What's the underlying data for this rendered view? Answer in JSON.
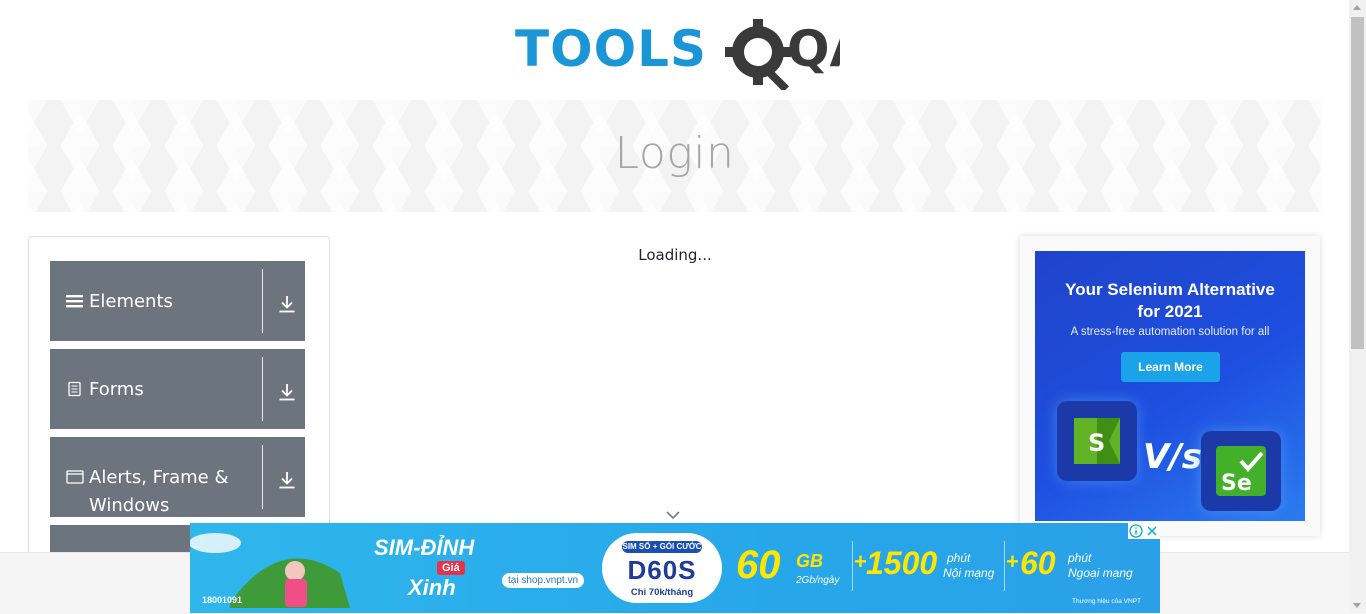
{
  "header": {
    "logo_text_left": "TOOLS",
    "logo_text_right": "QA",
    "logo_colors": {
      "tools": "#1a96d6",
      "qa": "#3a3a3a"
    }
  },
  "banner": {
    "title": "Login"
  },
  "sidebar": {
    "groups": [
      {
        "label": "Elements",
        "icon": "menu-bars-icon"
      },
      {
        "label": "Forms",
        "icon": "document-icon"
      },
      {
        "label": "Alerts, Frame & Windows",
        "icon": "window-icon"
      }
    ]
  },
  "main": {
    "loading_text": "Loading..."
  },
  "ad_right": {
    "headline_line1": "Your Selenium Alternative",
    "headline_line2": "for 2021",
    "subline": "A stress-free automation solution for all",
    "button": "Learn More",
    "vs_text": "V/s",
    "tile_left_letter": "S",
    "tile_right_letters": "Se",
    "colors": {
      "background": "#1f44c9",
      "button": "#1aa3e8",
      "tile_left": "#5fb324",
      "tile_right": "#43b02a"
    }
  },
  "ad_bottom": {
    "brand": "SIM-ĐỈNH",
    "price_tag": "Giá",
    "price_word": "Xinh",
    "shop_link": "tại shop.vnpt.vn",
    "bundle_tag": "SIM SỐ + GÓI CƯỚC",
    "bundle_code": "D60S",
    "bundle_price": "Chỉ 70k/tháng",
    "data_amount": "60",
    "data_unit": "GB",
    "data_rate": "2Gb/ngày",
    "plus_1": "+",
    "minutes_internal": "1500",
    "minutes_internal_unit": "phút",
    "minutes_internal_label": "Nội mạng",
    "plus_2": "+",
    "minutes_external": "60",
    "minutes_external_unit": "phút",
    "minutes_external_label": "Ngoại mạng",
    "hotline": "18001091",
    "vnpt_brand": "Thương hiệu của VNPT"
  }
}
